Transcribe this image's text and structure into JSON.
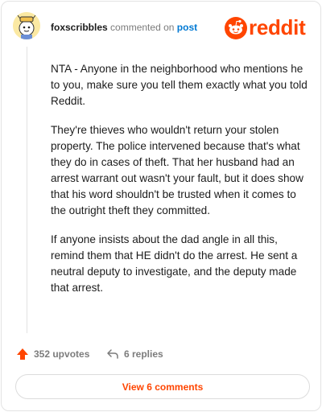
{
  "comment": {
    "username": "foxscribbles",
    "action_text": "commented on",
    "post_link": "post",
    "paragraphs": [
      "NTA - Anyone in the neighborhood who mentions he to you, make sure you tell them exactly what you told Reddit.",
      "They're thieves who wouldn't return your stolen property. The police intervened because that's what they do in cases of theft. That her husband had an arrest warrant out wasn't your fault, but it does show that his word shouldn't be trusted when it comes to the outright theft they committed.",
      "If anyone insists about the dad angle in all this, remind them that HE didn't do the arrest. He sent a neutral deputy to investigate, and the deputy made that arrest."
    ]
  },
  "brand": {
    "wordmark": "reddit",
    "color": "#ff4500"
  },
  "actions": {
    "upvotes": "352 upvotes",
    "replies": "6 replies"
  },
  "footer": {
    "view_comments": "View 6 comments"
  },
  "colors": {
    "accent": "#ff4500",
    "link": "#0079d3",
    "muted": "#7c7c7c"
  },
  "icons": [
    "avatar-icon",
    "reddit-snoo-icon",
    "upvote-arrow-icon",
    "reply-arrow-icon"
  ]
}
